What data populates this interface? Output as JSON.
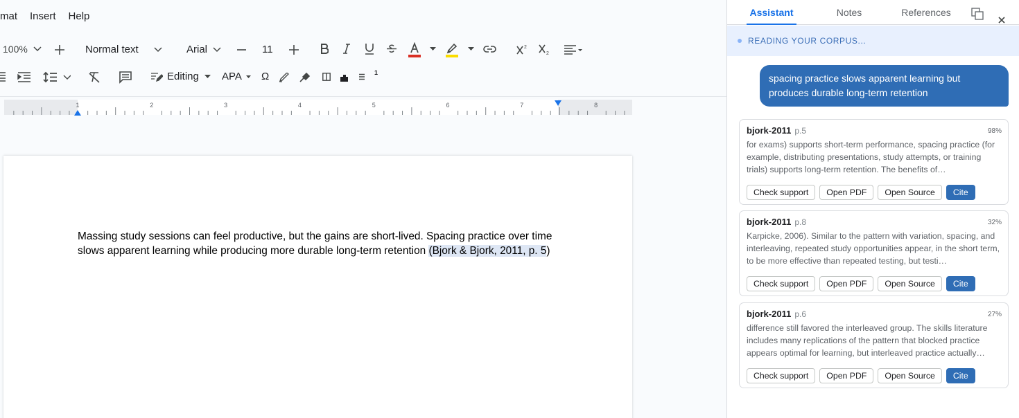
{
  "menubar": {
    "items": [
      "mat",
      "Insert",
      "Help"
    ]
  },
  "toolbar": {
    "zoom": "100%",
    "style": "Normal text",
    "font": "Arial",
    "font_size": "11",
    "mode": "Editing",
    "citation_style": "APA",
    "special_char": "Ω",
    "superscript_label": "1",
    "colors": {
      "text_color_bar": "#d93025",
      "highlight_bar": "#fbdd00"
    }
  },
  "ruler": {
    "numbers": [
      "1",
      "2",
      "3",
      "4",
      "5",
      "6",
      "7",
      "8"
    ]
  },
  "document": {
    "text_before": "Massing study sessions can feel productive, but the gains are short-lived. Spacing practice over time slows apparent learning while producing more durable long-term retention ",
    "citation": "(Bjork & Bjork, 2011, p. 5",
    "text_after": ")"
  },
  "sidebar": {
    "tabs": [
      "Assistant",
      "Notes",
      "References"
    ],
    "active_tab": "Assistant",
    "status": "READING YOUR CORPUS...",
    "query": "spacing practice slows apparent learning but produces durable long-term retention",
    "results": [
      {
        "source": "bjork-2011",
        "page": "p.5",
        "score": "98%",
        "snippet": "for exams) supports short-term performance, spacing practice (for example, distributing presentations, study attempts, or training trials) supports long-term retention. The benefits of…",
        "buttons": [
          "Check support",
          "Open PDF",
          "Open Source",
          "Cite"
        ]
      },
      {
        "source": "bjork-2011",
        "page": "p.8",
        "score": "32%",
        "snippet": "Karpicke, 2006). Similar to the pattern with variation, spacing, and interleaving, repeated study opportunities appear, in the short term, to be more effective than repeated testing, but testi…",
        "buttons": [
          "Check support",
          "Open PDF",
          "Open Source",
          "Cite"
        ]
      },
      {
        "source": "bjork-2011",
        "page": "p.6",
        "score": "27%",
        "snippet": "difference still favored the interleaved group. The skills literature includes many replications of the pattern that blocked practice appears optimal for learning, but interleaved practice actually…",
        "buttons": [
          "Check support",
          "Open PDF",
          "Open Source",
          "Cite"
        ]
      }
    ],
    "accent_color": "#2f6db5"
  }
}
